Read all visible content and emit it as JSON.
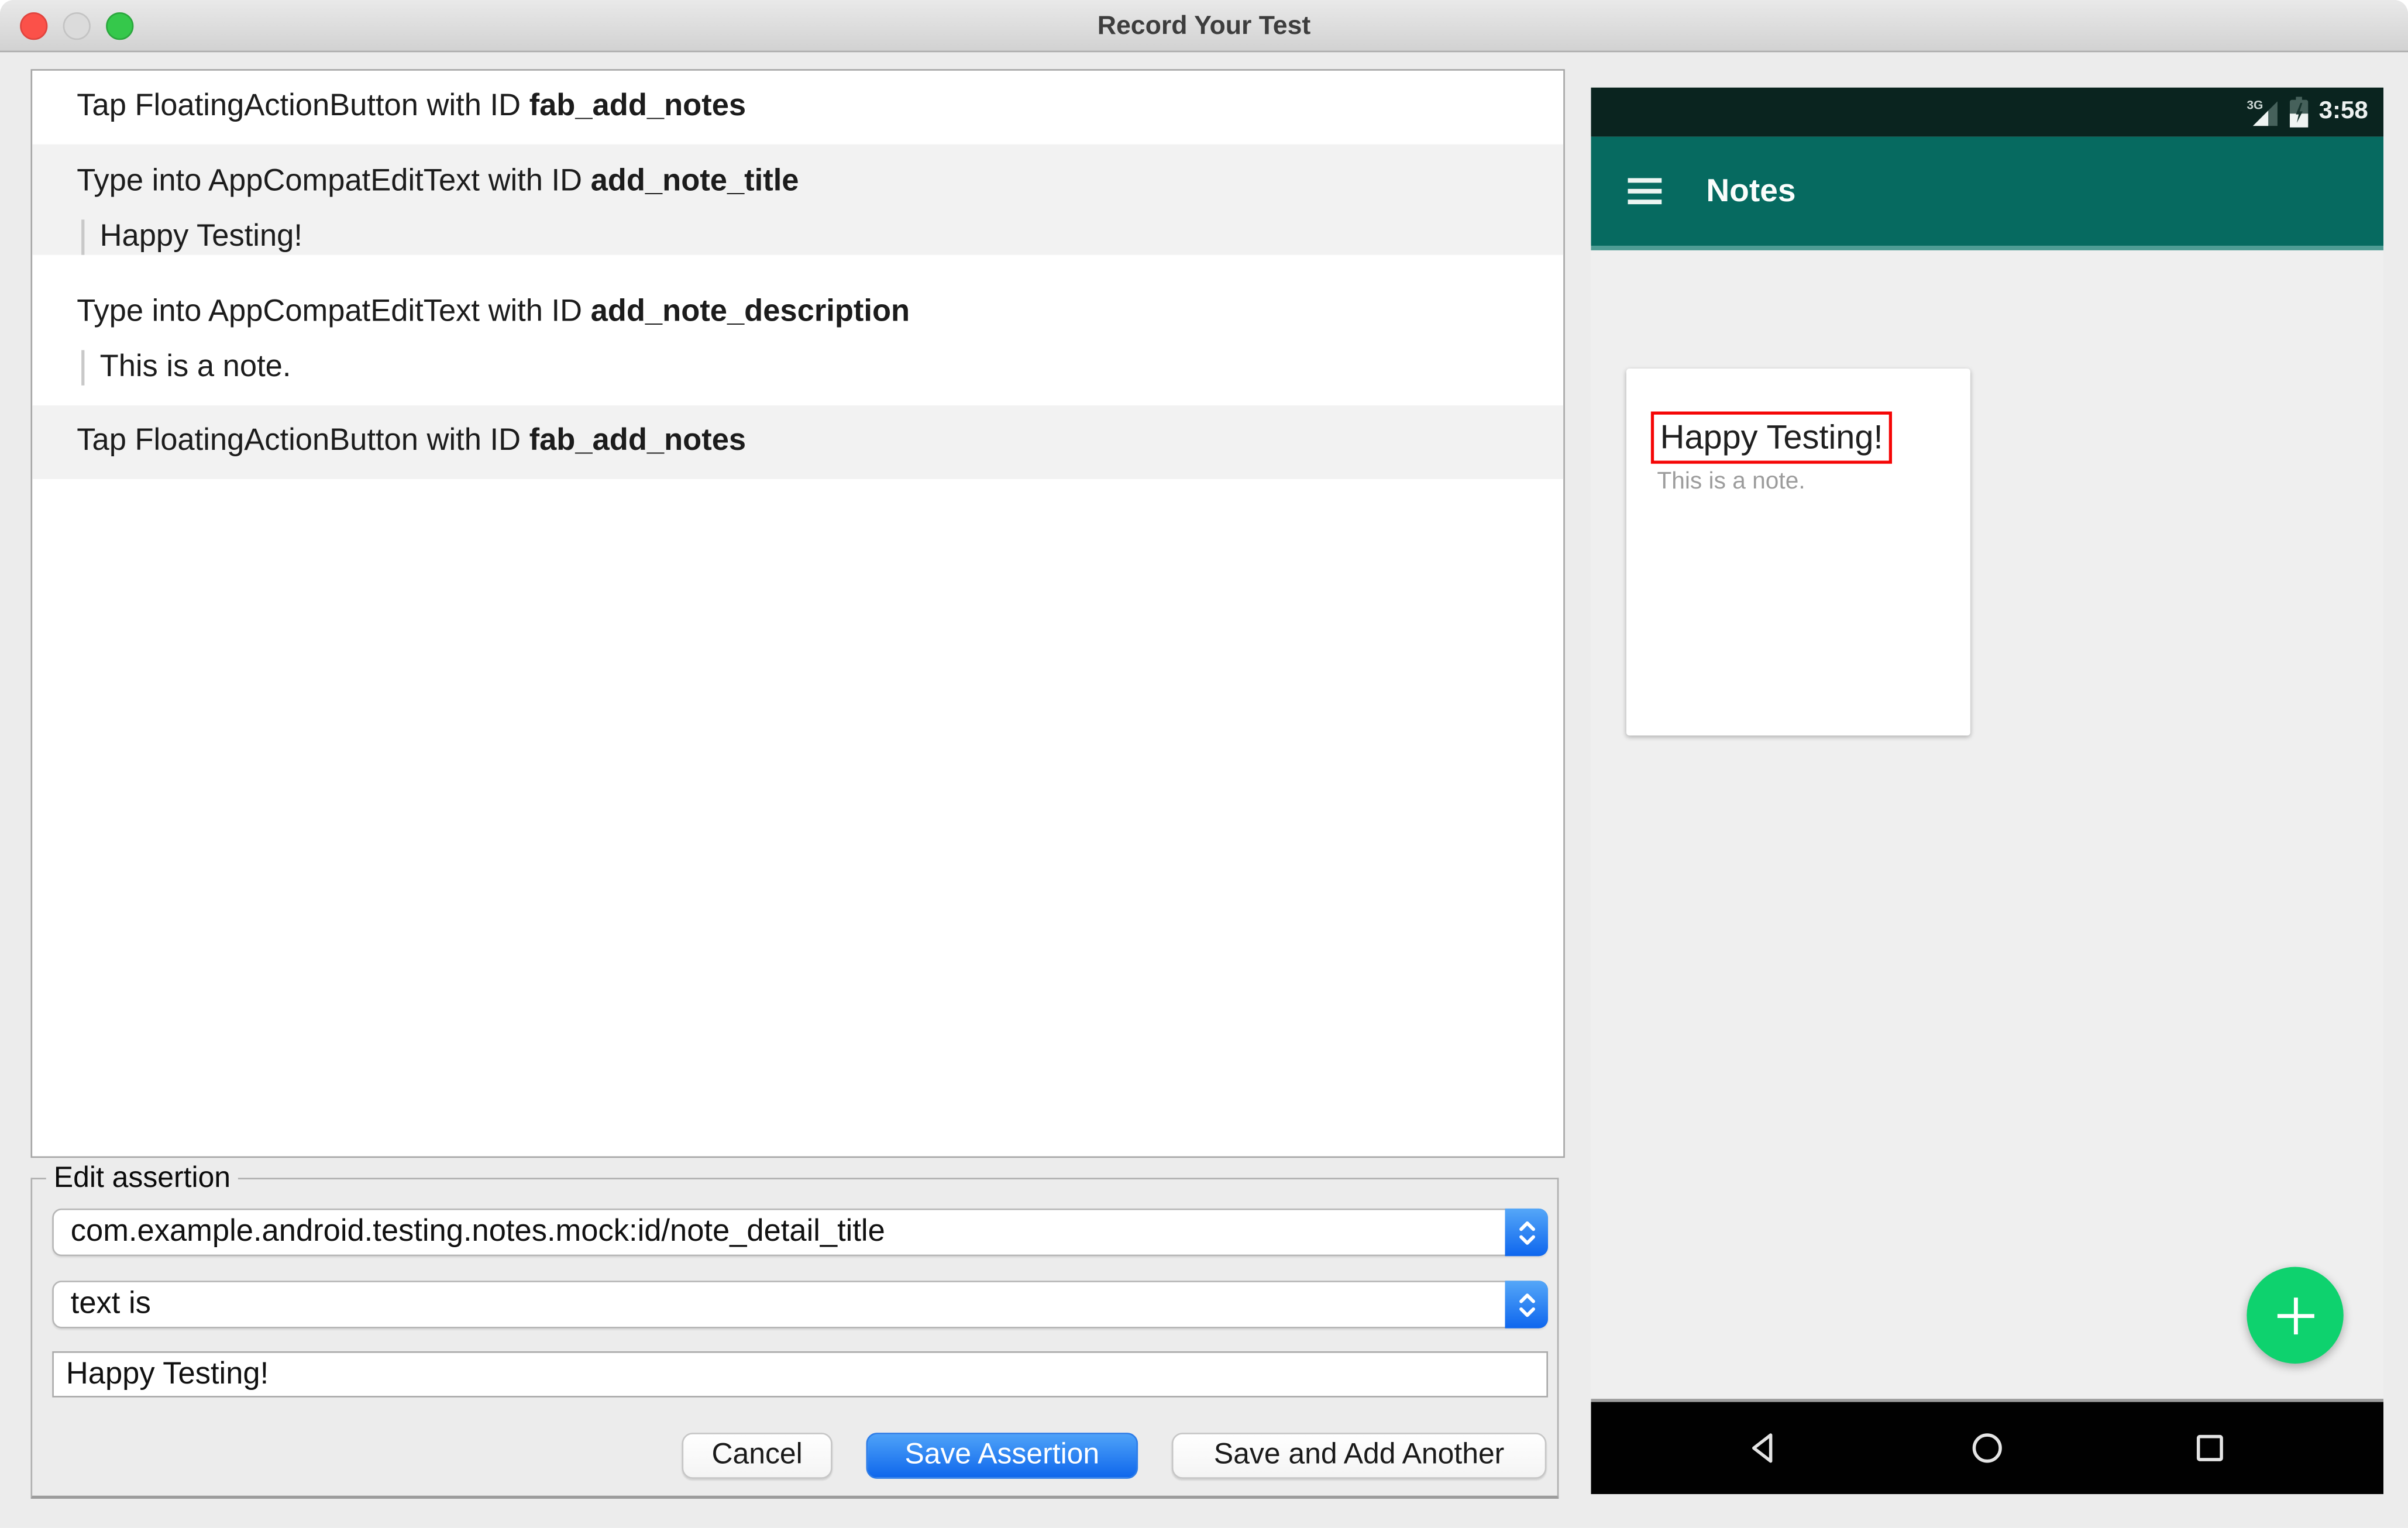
{
  "window": {
    "title": "Record Your Test"
  },
  "action_list": {
    "items": [
      {
        "prefix": "Tap FloatingActionButton with ID ",
        "id": "fab_add_notes",
        "value": null
      },
      {
        "prefix": "Type into AppCompatEditText with ID ",
        "id": "add_note_title",
        "value": "Happy Testing!"
      },
      {
        "prefix": "Type into AppCompatEditText with ID ",
        "id": "add_note_description",
        "value": "This is a note."
      },
      {
        "prefix": "Tap FloatingActionButton with ID ",
        "id": "fab_add_notes",
        "value": null
      }
    ]
  },
  "edit_assertion": {
    "legend": "Edit assertion",
    "target_selector": {
      "value": "com.example.android.testing.notes.mock:id/note_detail_title"
    },
    "condition_selector": {
      "value": "text is"
    },
    "value_input": {
      "value": "Happy Testing!"
    },
    "buttons": {
      "cancel": "Cancel",
      "save": "Save Assertion",
      "save_add": "Save and Add Another"
    }
  },
  "device": {
    "status_bar": {
      "network": "3G",
      "time": "3:58"
    },
    "toolbar": {
      "title": "Notes"
    },
    "note_card": {
      "title": "Happy Testing!",
      "description": "This is a note."
    }
  },
  "colors": {
    "toolbar_teal": "#066A60",
    "status_bar_dark": "#0A241F",
    "fab_green": "#0ED26E",
    "accent_blue": "#0F67EC",
    "assertion_highlight_red": "#F50505",
    "nav_bar_black": "#010101"
  }
}
